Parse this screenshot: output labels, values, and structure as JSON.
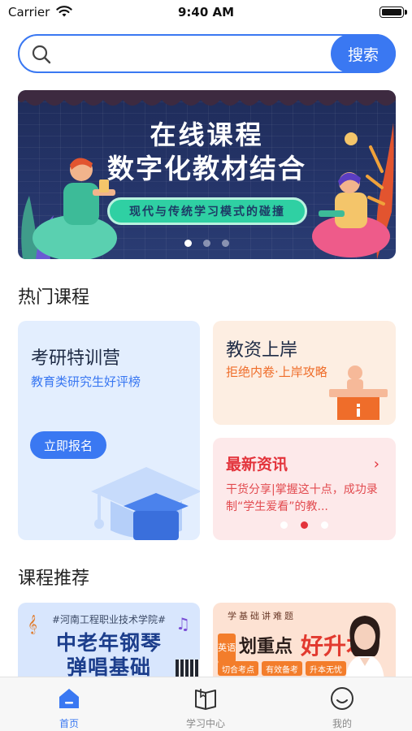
{
  "status_bar": {
    "carrier": "Carrier",
    "time": "9:40 AM"
  },
  "search": {
    "placeholder": "",
    "button_label": "搜索"
  },
  "banner": {
    "title": "在线课程",
    "subtitle": "数字化教材结合",
    "tagline": "现代与传统学习模式的碰撞",
    "dots": 3,
    "active_dot": 0
  },
  "hot_section": {
    "title": "热门课程",
    "main_card": {
      "title": "考研特训营",
      "subtitle": "教育类研究生好评榜",
      "button_label": "立即报名"
    },
    "side_card": {
      "title": "教资上岸",
      "subtitle": "拒绝内卷·上岸攻略"
    },
    "news_card": {
      "title": "最新资讯",
      "text": "干货分享|掌握这十点，成功录制“学生爱看”的教...",
      "dots": 3,
      "active_dot": 1
    }
  },
  "recommend_section": {
    "title": "课程推荐",
    "course1": {
      "school": "#河南工程职业技术学院#",
      "line1": "中老年钢琴",
      "line2": "弹唱基础"
    },
    "course2": {
      "top_text": "学基础讲难题",
      "tag": "英语",
      "headline_a": "划重点",
      "headline_b": "好升本",
      "chips": [
        "切合考点",
        "有效备考",
        "升本无忧"
      ]
    }
  },
  "tab_bar": {
    "items": [
      {
        "label": "首页",
        "icon": "home-icon",
        "active": true
      },
      {
        "label": "学习中心",
        "icon": "book-icon",
        "active": false
      },
      {
        "label": "我的",
        "icon": "smile-icon",
        "active": false
      }
    ]
  },
  "colors": {
    "accent": "#3a78f2",
    "orange": "#ef6d2a",
    "red": "#e3333b"
  }
}
